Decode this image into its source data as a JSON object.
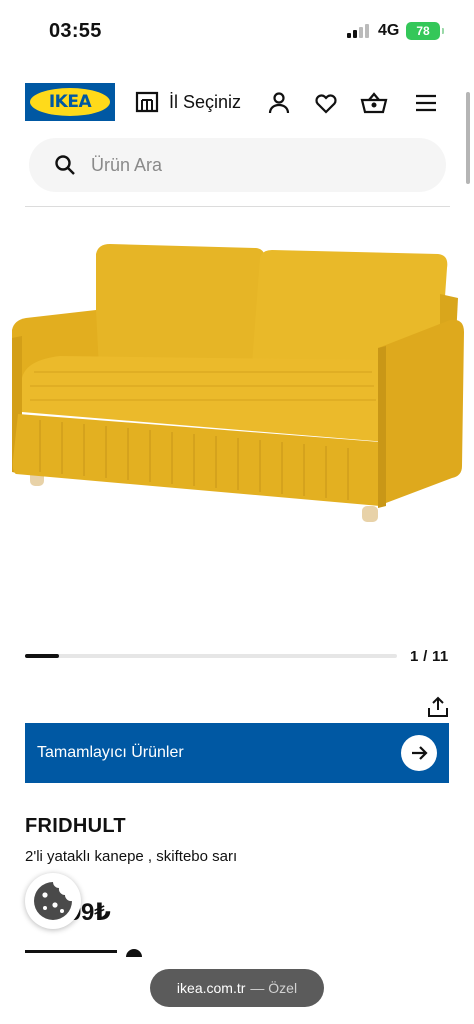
{
  "status_bar": {
    "time": "03:55",
    "network": "4G",
    "battery": "78"
  },
  "header": {
    "logo_text": "IKEA",
    "store_label": "İl Seçiniz",
    "icons": [
      "store-icon",
      "user-icon",
      "heart-icon",
      "basket-icon",
      "menu-icon"
    ]
  },
  "search": {
    "placeholder": "Ürün Ara",
    "value": ""
  },
  "gallery": {
    "counter": "1 / 11",
    "current": 1,
    "total": 11,
    "image_subject": "yellow two-seat sofa-bed"
  },
  "complementary": {
    "label": "Tamamlayıcı Ürünler"
  },
  "product": {
    "name": "FRIDHULT",
    "description": "2'li yataklı kanepe , skiftebo sarı",
    "price_visible": "99₺"
  },
  "browser": {
    "url": "ikea.com.tr",
    "mode": "— Özel"
  },
  "colors": {
    "brand_blue": "#0058a3",
    "brand_yellow": "#ffda1a",
    "sofa_yellow": "#e5b224",
    "battery_green": "#34c759"
  }
}
